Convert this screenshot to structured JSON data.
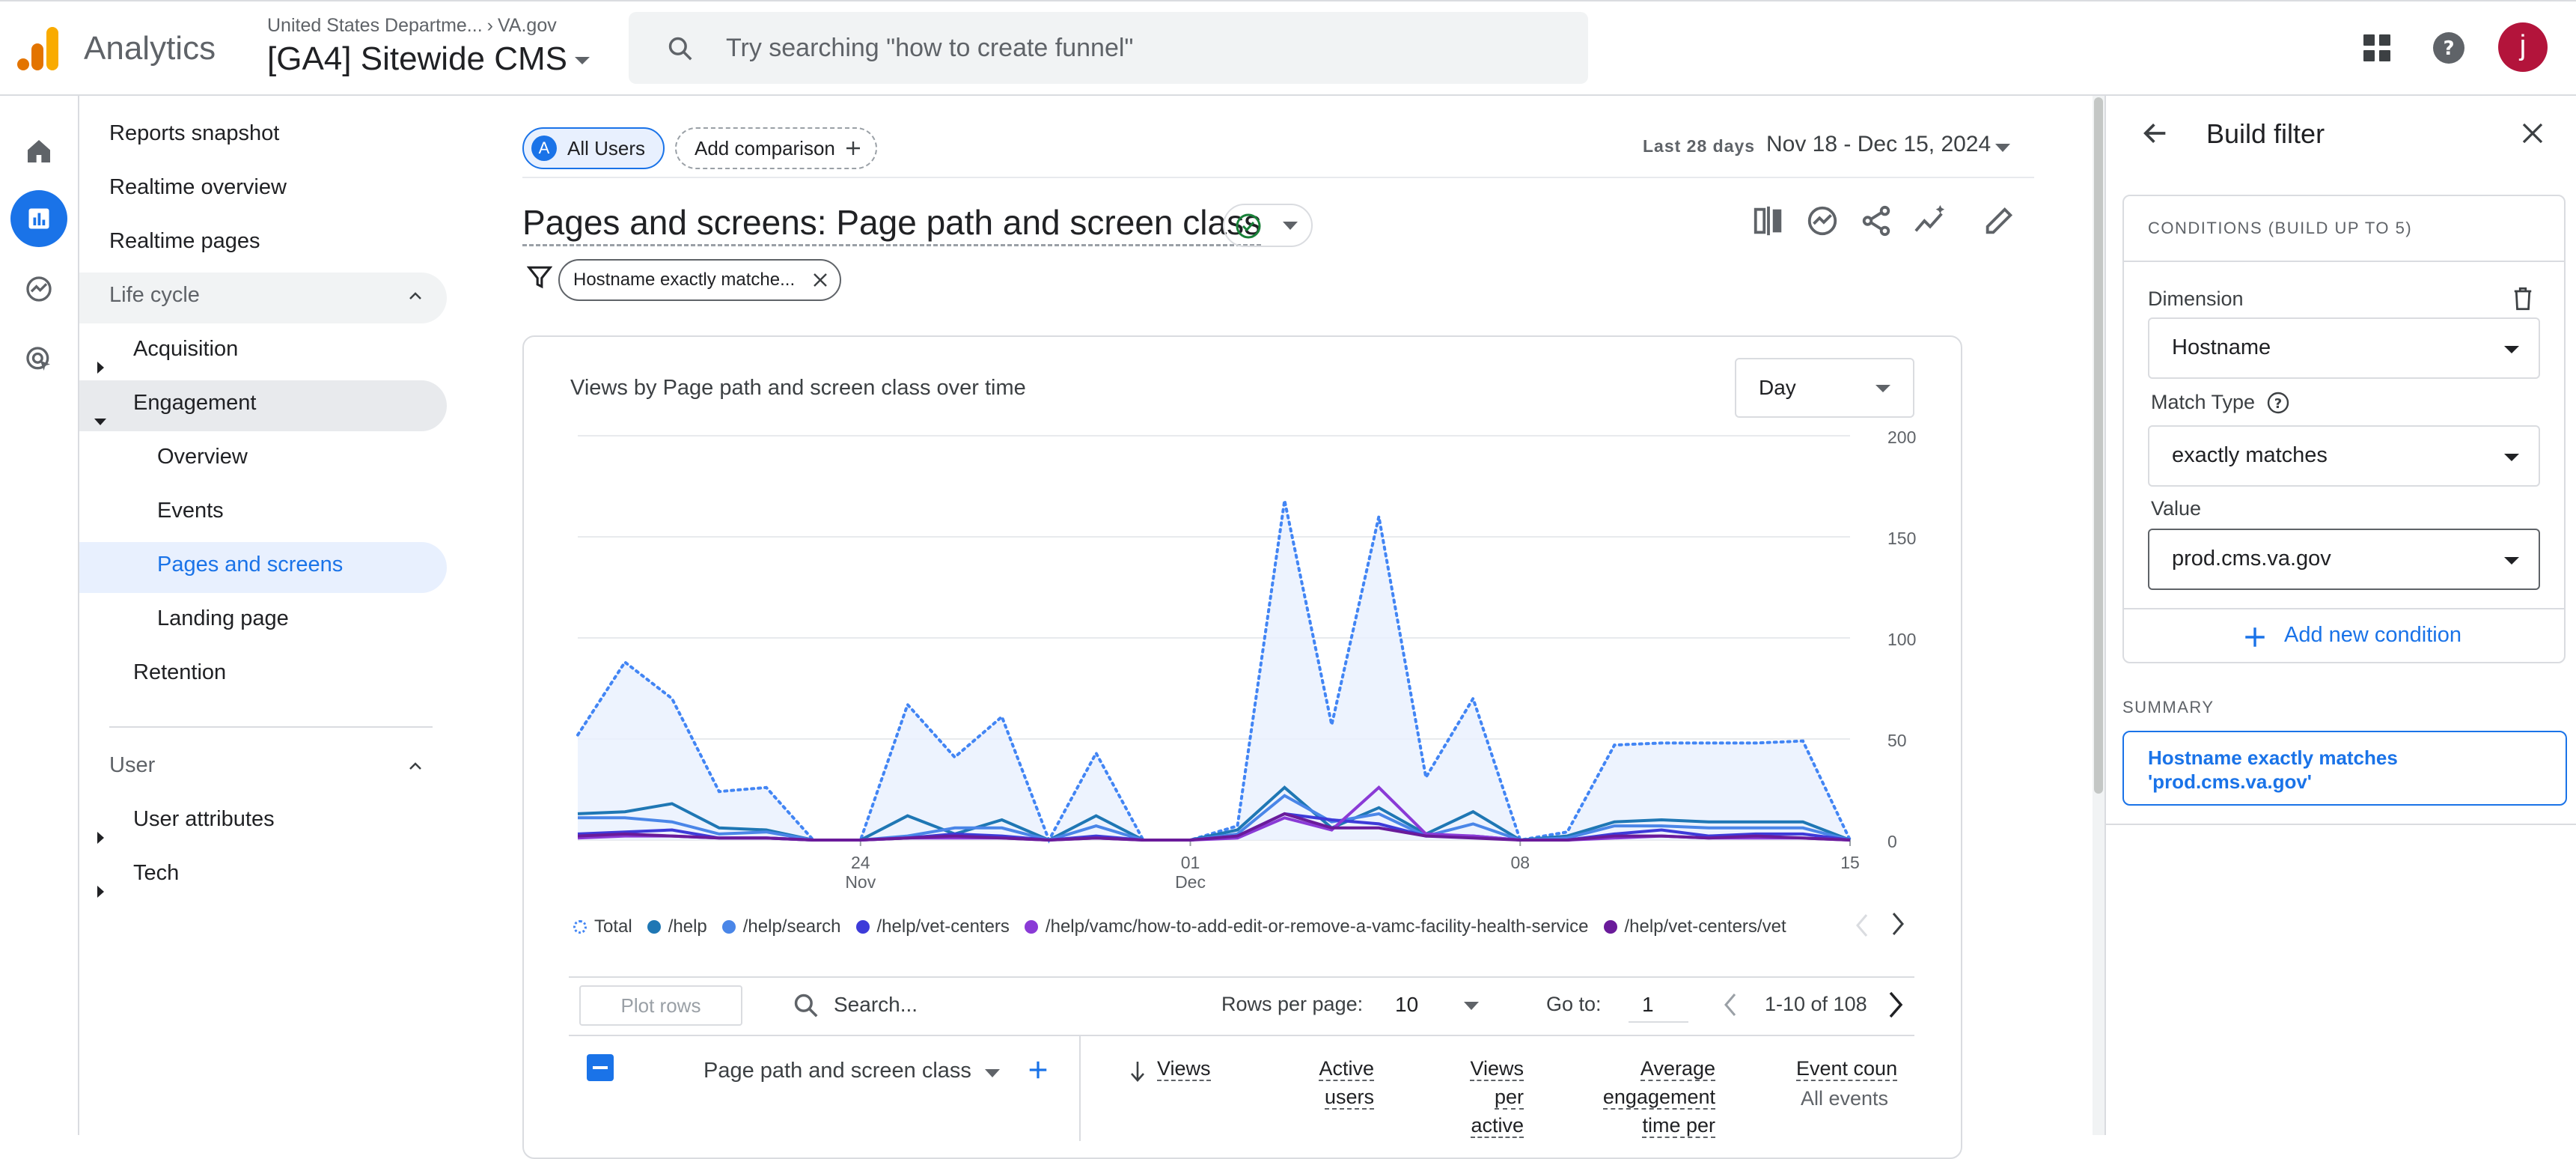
{
  "topbar": {
    "app_name": "Analytics",
    "account_path": "United States Departme...",
    "account_child": "VA.gov",
    "property_name": "[GA4] Sitewide CMS",
    "search_placeholder": "Try searching \"how to create funnel\"",
    "avatar_letter": "j"
  },
  "nav": {
    "reports_snapshot": "Reports snapshot",
    "realtime_overview": "Realtime overview",
    "realtime_pages": "Realtime pages",
    "lifecycle_section": "Life cycle",
    "acquisition": "Acquisition",
    "engagement": "Engagement",
    "overview": "Overview",
    "events": "Events",
    "pages_and_screens": "Pages and screens",
    "landing_page": "Landing page",
    "retention": "Retention",
    "user_section": "User",
    "user_attributes": "User attributes",
    "tech": "Tech"
  },
  "report": {
    "segment_badge": "A",
    "segment_label": "All Users",
    "add_comparison": "Add comparison",
    "date_label": "Last 28 days",
    "date_range": "Nov 18 - Dec 15, 2024",
    "title": "Pages and screens: Page path and screen class",
    "filter_chip": "Hostname exactly matche...",
    "chart_title": "Views by Page path and screen class over time",
    "granularity": "Day"
  },
  "colors": {
    "accent": "#1a73e8",
    "total": "#4285f4",
    "help": "#1f77b4",
    "help_search": "#4a86e8",
    "help_vet_centers": "#3d3bd9",
    "help_vamc": "#8a3ad6",
    "help_vet_centers_2": "#6a1b9a"
  },
  "chart_data": {
    "type": "line",
    "x_ticks": [
      {
        "day": "24",
        "month": "Nov"
      },
      {
        "day": "01",
        "month": "Dec"
      },
      {
        "day": "08",
        "month": ""
      },
      {
        "day": "15",
        "month": ""
      }
    ],
    "x": [
      "Nov 18",
      "Nov 19",
      "Nov 20",
      "Nov 21",
      "Nov 22",
      "Nov 23",
      "Nov 24",
      "Nov 25",
      "Nov 26",
      "Nov 27",
      "Nov 28",
      "Nov 29",
      "Nov 30",
      "Dec 1",
      "Dec 2",
      "Dec 3",
      "Dec 4",
      "Dec 5",
      "Dec 6",
      "Dec 7",
      "Dec 8",
      "Dec 9",
      "Dec 10",
      "Dec 11",
      "Dec 12",
      "Dec 13",
      "Dec 14",
      "Dec 15"
    ],
    "ylim": [
      0,
      200
    ],
    "y_ticks": [
      "0",
      "50",
      "100",
      "150",
      "200"
    ],
    "grid": true,
    "series": [
      {
        "name": "Total",
        "style": "dotted-area",
        "color_key": "total",
        "values": [
          52,
          88,
          70,
          24,
          26,
          0,
          0,
          67,
          41,
          61,
          0,
          43,
          0,
          0,
          7,
          168,
          57,
          160,
          31,
          70,
          0,
          4,
          47,
          48,
          48,
          48,
          49,
          0
        ]
      },
      {
        "name": "/help",
        "color_key": "help",
        "values": [
          13,
          14,
          18,
          6,
          5,
          0,
          0,
          12,
          3,
          10,
          0,
          12,
          0,
          0,
          5,
          26,
          6,
          16,
          3,
          14,
          0,
          2,
          9,
          10,
          9,
          9,
          9,
          0
        ]
      },
      {
        "name": "/help/search",
        "color_key": "help_search",
        "values": [
          11,
          11,
          9,
          3,
          4,
          0,
          0,
          2,
          6,
          6,
          0,
          7,
          0,
          0,
          3,
          22,
          9,
          13,
          2,
          8,
          0,
          1,
          7,
          7,
          6,
          6,
          6,
          0
        ]
      },
      {
        "name": "/help/vet-centers",
        "color_key": "help_vet_centers",
        "values": [
          3,
          4,
          5,
          1,
          1,
          0,
          0,
          1,
          3,
          2,
          0,
          2,
          0,
          0,
          2,
          13,
          10,
          8,
          2,
          2,
          0,
          0,
          3,
          5,
          2,
          3,
          3,
          0
        ]
      },
      {
        "name": "/help/vamc/how-to-add-edit-or-remove-a-vamc-facility-health-service",
        "color_key": "help_vamc",
        "values": [
          1,
          2,
          2,
          1,
          1,
          0,
          0,
          1,
          1,
          1,
          0,
          1,
          0,
          0,
          1,
          11,
          5,
          26,
          3,
          2,
          0,
          0,
          1,
          2,
          1,
          1,
          1,
          0
        ]
      },
      {
        "name": "/help/vet-centers/vet",
        "color_key": "help_vet_centers_2",
        "values": [
          2,
          3,
          2,
          1,
          1,
          0,
          0,
          1,
          2,
          1,
          0,
          1,
          0,
          0,
          2,
          13,
          6,
          6,
          2,
          1,
          0,
          0,
          2,
          2,
          1,
          2,
          1,
          0
        ]
      }
    ]
  },
  "table": {
    "plot_rows": "Plot rows",
    "search_placeholder": "Search...",
    "rows_per_page_label": "Rows per page:",
    "rows_per_page": "10",
    "goto_label": "Go to:",
    "goto_value": "1",
    "page_range": "1-10 of 108",
    "dimension_header": "Page path and screen class",
    "col_views": "Views",
    "col_active_1": "Active",
    "col_active_2": "users",
    "col_vpa_1": "Views",
    "col_vpa_2": "per",
    "col_vpa_3": "active",
    "col_avg_1": "Average",
    "col_avg_2": "engagement",
    "col_avg_3": "time per",
    "col_events": "Event coun",
    "col_events_sub": "All events"
  },
  "panel": {
    "title": "Build filter",
    "conditions_title": "CONDITIONS (BUILD UP TO 5)",
    "dimension_label": "Dimension",
    "dimension_value": "Hostname",
    "match_type_label": "Match Type",
    "match_type_value": "exactly matches",
    "value_label": "Value",
    "value_value": "prod.cms.va.gov",
    "add_condition": "Add new condition",
    "summary_label": "SUMMARY",
    "summary_line1": "Hostname exactly matches",
    "summary_line2": "'prod.cms.va.gov'"
  }
}
